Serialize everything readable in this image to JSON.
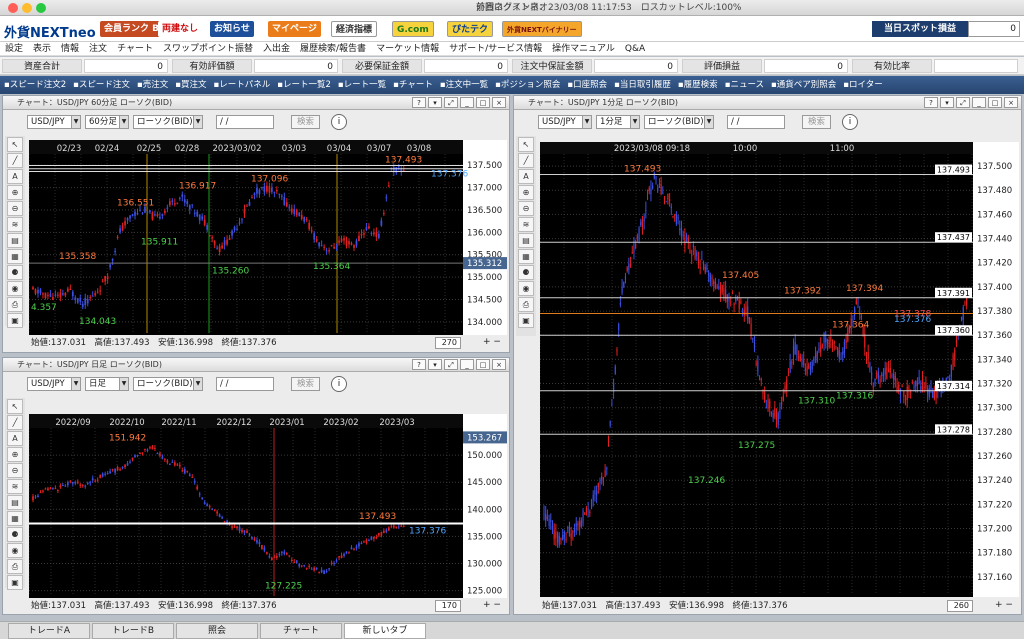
{
  "window": {
    "title": "外貨ネクストネオ"
  },
  "header": {
    "login_info": "前回ログイン日：23/03/08 11:17:53　ロスカットレベル:100%",
    "logo_main": "外貨NEXTneo",
    "logo_sub": "外貨",
    "rank_label": "会員ランク Bronze",
    "two_way": "両建なし",
    "oshirase": "お知らせ",
    "mypage": "マイページ",
    "keizai": "経済指標",
    "gcom": "G.com",
    "pitatech": "ぴたテク",
    "binary": "外貨NEXTバイナリー",
    "spot_label": "当日スポット損益",
    "spot_value": "0"
  },
  "menu": {
    "items": [
      "設定",
      "表示",
      "情報",
      "注文",
      "チャート",
      "スワップポイント振替",
      "入出金",
      "履歴検索/報告書",
      "マーケット情報",
      "サポート/サービス情報",
      "操作マニュアル",
      "Q&A"
    ]
  },
  "account": {
    "items": [
      {
        "label": "資産合計",
        "value": "0"
      },
      {
        "label": "有効評価額",
        "value": "0"
      },
      {
        "label": "必要保証金額",
        "value": "0"
      },
      {
        "label": "注文中保証金額",
        "value": "0"
      },
      {
        "label": "評価損益",
        "value": "0"
      },
      {
        "label": "有効比率",
        "value": ""
      }
    ]
  },
  "toolbar": {
    "items": [
      "スピード注文2",
      "スピード注文",
      "売注文",
      "買注文",
      "レートパネル",
      "レート一覧2",
      "レート一覧",
      "チャート",
      "注文中一覧",
      "ポジション照会",
      "口座照会",
      "当日取引履歴",
      "履歴検索",
      "ニュース",
      "通貨ペア別照会",
      "ロイター"
    ]
  },
  "chart60": {
    "title": "チャート：USD/JPY 60分足 ローソク(BID)",
    "pair": "USD/JPY",
    "period": "60分足",
    "type": "ローソク(BID)",
    "date": "/ /",
    "search": "検索",
    "status": "始値:137.031　高値:137.493　安値:136.998　終値:137.376",
    "count": "270",
    "xlabels": [
      "02/23",
      "02/24",
      "02/25",
      "02/28",
      "2023/03/02",
      "03/03",
      "03/04",
      "03/07",
      "03/08"
    ],
    "ylabels": [
      "137.500",
      "137.000",
      "136.500",
      "136.000",
      "135.500",
      "135.000",
      "134.500",
      "134.000"
    ],
    "current": "135.312",
    "annotations": {
      "high1": "137.493",
      "h2": "137.096",
      "h3": "136.917",
      "h4": "136.551",
      "l1": "135.911",
      "l2": "135.260",
      "l3": "135.364",
      "h5": "135.358",
      "l4": "134.043",
      "l5": "4.357",
      "last": "137.376"
    }
  },
  "chartDay": {
    "title": "チャート：USD/JPY 日足 ローソク(BID)",
    "pair": "USD/JPY",
    "period": "日足",
    "type": "ローソク(BID)",
    "date": "/ /",
    "search": "検索",
    "status": "始値:137.031　高値:137.493　安値:136.998　終値:137.376",
    "count": "170",
    "xlabels": [
      "2022/09",
      "2022/10",
      "2022/11",
      "2022/12",
      "2023/01",
      "2023/02",
      "2023/03"
    ],
    "ylabels": [
      "150.000",
      "145.000",
      "140.000",
      "135.000",
      "130.000",
      "125.000"
    ],
    "current": "153.267",
    "annotations": {
      "high": "151.942",
      "low": "127.225",
      "h1": "137.493",
      "last": "137.376"
    }
  },
  "chart1m": {
    "title": "チャート：USD/JPY 1分足 ローソク(BID)",
    "pair": "USD/JPY",
    "period": "1分足",
    "type": "ローソク(BID)",
    "date": "/ /",
    "search": "検索",
    "status": "始値:137.031　高値:137.493　安値:136.998　終値:137.376",
    "count": "260",
    "xlabels": [
      "2023/03/08 09:18",
      "10:00",
      "11:00"
    ],
    "ylabels": [
      "137.500",
      "137.480",
      "137.460",
      "137.440",
      "137.420",
      "137.400",
      "137.380",
      "137.360",
      "137.340",
      "137.320",
      "137.300",
      "137.280",
      "137.260",
      "137.240",
      "137.220",
      "137.200",
      "137.180",
      "137.160"
    ],
    "hlines": [
      "137.493",
      "137.437",
      "137.391",
      "137.360",
      "137.314",
      "137.278"
    ],
    "annotations": {
      "a1": "137.493",
      "a2": "137.405",
      "a3": "137.392",
      "a4": "137.394",
      "a5": "137.364",
      "a6": "137.378",
      "a7": "137.376",
      "a8": "137.310",
      "a9": "137.316",
      "a10": "137.275",
      "a11": "137.246"
    }
  },
  "tabs": [
    "トレードA",
    "トレードB",
    "照会",
    "チャート",
    "新しいタブ"
  ]
}
